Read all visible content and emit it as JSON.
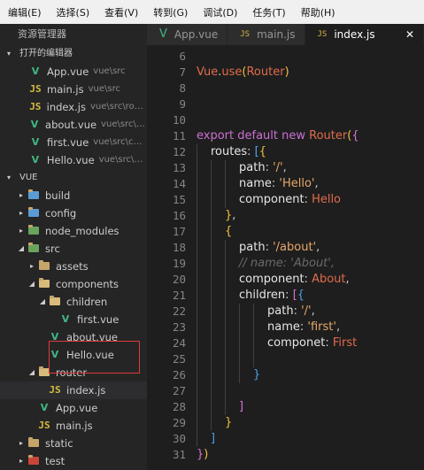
{
  "menu": [
    "编辑(E)",
    "选择(S)",
    "查看(V)",
    "转到(G)",
    "调试(D)",
    "任务(T)",
    "帮助(H)"
  ],
  "sidebar": {
    "title": "资源管理器",
    "open_editors_label": "打开的编辑器",
    "open_editors": [
      {
        "name": "App.vue",
        "path": "vue\\src",
        "type": "vue"
      },
      {
        "name": "main.js",
        "path": "vue\\src",
        "type": "js"
      },
      {
        "name": "index.js",
        "path": "vue\\src\\rou...",
        "type": "js"
      },
      {
        "name": "about.vue",
        "path": "vue\\src\\ro...",
        "type": "vue"
      },
      {
        "name": "first.vue",
        "path": "vue\\src\\co...",
        "type": "vue"
      },
      {
        "name": "Hello.vue",
        "path": "vue\\src\\c...",
        "type": "vue"
      }
    ],
    "project_label": "VUE",
    "tree": [
      {
        "name": "build",
        "kind": "folder",
        "color": "#5a9bd4",
        "depth": 1,
        "arrow": "▸"
      },
      {
        "name": "config",
        "kind": "folder",
        "color": "#5a9bd4",
        "depth": 1,
        "arrow": "▸"
      },
      {
        "name": "node_modules",
        "kind": "folder",
        "color": "#6aa35c",
        "depth": 1,
        "arrow": "▸"
      },
      {
        "name": "src",
        "kind": "folder",
        "color": "#6aa35c",
        "depth": 1,
        "arrow": "◢"
      },
      {
        "name": "assets",
        "kind": "folder",
        "color": "#c5a56a",
        "depth": 2,
        "arrow": "▸"
      },
      {
        "name": "components",
        "kind": "folder",
        "color": "#d8bb7b",
        "depth": 2,
        "arrow": "◢"
      },
      {
        "name": "children",
        "kind": "folder",
        "color": "#d8bb7b",
        "depth": 3,
        "arrow": "◢"
      },
      {
        "name": "first.vue",
        "kind": "vue",
        "depth": 4
      },
      {
        "name": "about.vue",
        "kind": "vue",
        "depth": 3
      },
      {
        "name": "Hello.vue",
        "kind": "vue",
        "depth": 3
      },
      {
        "name": "router",
        "kind": "folder",
        "color": "#d8bb7b",
        "depth": 2,
        "arrow": "◢"
      },
      {
        "name": "index.js",
        "kind": "js",
        "depth": 3,
        "active": true
      },
      {
        "name": "App.vue",
        "kind": "vue",
        "depth": 2
      },
      {
        "name": "main.js",
        "kind": "js",
        "depth": 2
      },
      {
        "name": "static",
        "kind": "folder",
        "color": "#c5a56a",
        "depth": 1,
        "arrow": "▸"
      },
      {
        "name": "test",
        "kind": "folder",
        "color": "#c9453a",
        "depth": 1,
        "arrow": "▸"
      }
    ]
  },
  "tabs": [
    {
      "label": "App.vue",
      "type": "vue",
      "active": false
    },
    {
      "label": "main.js",
      "type": "js",
      "active": false
    },
    {
      "label": "index.js",
      "type": "js",
      "active": true
    }
  ],
  "tab_icon_js": "JS",
  "tab_icon_vue": "V",
  "close_glyph": "✕",
  "editor": {
    "lines": [
      {
        "n": "6",
        "guides": 0,
        "tokens": []
      },
      {
        "n": "7",
        "guides": 0,
        "tokens": [
          {
            "t": "Vue",
            "c": "cls"
          },
          {
            "t": ".",
            "c": "punc"
          },
          {
            "t": "use",
            "c": "fn"
          },
          {
            "t": "(",
            "c": "brk-y"
          },
          {
            "t": "Router",
            "c": "cls"
          },
          {
            "t": ")",
            "c": "brk-y"
          }
        ]
      },
      {
        "n": "8",
        "guides": 0,
        "tokens": []
      },
      {
        "n": "9",
        "guides": 0,
        "tokens": []
      },
      {
        "n": "10",
        "guides": 0,
        "tokens": []
      },
      {
        "n": "11",
        "guides": 0,
        "tokens": [
          {
            "t": "export ",
            "c": "kw"
          },
          {
            "t": "default ",
            "c": "kw"
          },
          {
            "t": "new ",
            "c": "kw"
          },
          {
            "t": "Router",
            "c": "cls"
          },
          {
            "t": "(",
            "c": "brk-y"
          },
          {
            "t": "{",
            "c": "brk-p"
          }
        ]
      },
      {
        "n": "12",
        "guides": 1,
        "tokens": [
          {
            "t": "routes",
            "c": "prop"
          },
          {
            "t": ": ",
            "c": "punc"
          },
          {
            "t": "[",
            "c": "brk-b"
          },
          {
            "t": "{",
            "c": "brk-y"
          }
        ]
      },
      {
        "n": "13",
        "guides": 3,
        "tokens": [
          {
            "t": "path",
            "c": "prop"
          },
          {
            "t": ": ",
            "c": "punc"
          },
          {
            "t": "'/'",
            "c": "str"
          },
          {
            "t": ",",
            "c": "punc"
          }
        ]
      },
      {
        "n": "14",
        "guides": 3,
        "tokens": [
          {
            "t": "name",
            "c": "prop"
          },
          {
            "t": ": ",
            "c": "punc"
          },
          {
            "t": "'Hello'",
            "c": "str"
          },
          {
            "t": ",",
            "c": "punc"
          }
        ]
      },
      {
        "n": "15",
        "guides": 3,
        "tokens": [
          {
            "t": "component",
            "c": "prop"
          },
          {
            "t": ": ",
            "c": "punc"
          },
          {
            "t": "Hello",
            "c": "cls"
          }
        ]
      },
      {
        "n": "16",
        "guides": 2,
        "tokens": [
          {
            "t": "}",
            "c": "brk-y"
          },
          {
            "t": ",",
            "c": "punc"
          }
        ]
      },
      {
        "n": "17",
        "guides": 2,
        "tokens": [
          {
            "t": "{",
            "c": "brk-y"
          }
        ]
      },
      {
        "n": "18",
        "guides": 3,
        "tokens": [
          {
            "t": "path",
            "c": "prop"
          },
          {
            "t": ": ",
            "c": "punc"
          },
          {
            "t": "'/about'",
            "c": "str"
          },
          {
            "t": ",",
            "c": "punc"
          }
        ]
      },
      {
        "n": "19",
        "guides": 3,
        "tokens": [
          {
            "t": "// name: 'About',",
            "c": "cmt"
          }
        ]
      },
      {
        "n": "20",
        "guides": 3,
        "tokens": [
          {
            "t": "component",
            "c": "prop"
          },
          {
            "t": ": ",
            "c": "punc"
          },
          {
            "t": "About",
            "c": "cls"
          },
          {
            "t": ",",
            "c": "punc"
          }
        ]
      },
      {
        "n": "21",
        "guides": 3,
        "tokens": [
          {
            "t": "children",
            "c": "prop"
          },
          {
            "t": ": ",
            "c": "punc"
          },
          {
            "t": "[",
            "c": "brk-p"
          },
          {
            "t": "{",
            "c": "brk-b"
          }
        ]
      },
      {
        "n": "22",
        "guides": 5,
        "tokens": [
          {
            "t": "path",
            "c": "prop"
          },
          {
            "t": ": ",
            "c": "punc"
          },
          {
            "t": "'/'",
            "c": "str"
          },
          {
            "t": ",",
            "c": "punc"
          }
        ]
      },
      {
        "n": "23",
        "guides": 5,
        "tokens": [
          {
            "t": "name",
            "c": "prop"
          },
          {
            "t": ": ",
            "c": "punc"
          },
          {
            "t": "'first'",
            "c": "str"
          },
          {
            "t": ",",
            "c": "punc"
          }
        ]
      },
      {
        "n": "24",
        "guides": 5,
        "tokens": [
          {
            "t": "componet",
            "c": "prop"
          },
          {
            "t": ": ",
            "c": "punc"
          },
          {
            "t": "First",
            "c": "cls"
          }
        ]
      },
      {
        "n": "25",
        "guides": 5,
        "tokens": []
      },
      {
        "n": "26",
        "guides": 4,
        "tokens": [
          {
            "t": "}",
            "c": "brk-b"
          }
        ]
      },
      {
        "n": "27",
        "guides": 3,
        "tokens": []
      },
      {
        "n": "28",
        "guides": 3,
        "tokens": [
          {
            "t": "]",
            "c": "brk-p"
          }
        ]
      },
      {
        "n": "29",
        "guides": 2,
        "tokens": [
          {
            "t": "}",
            "c": "brk-y"
          }
        ]
      },
      {
        "n": "30",
        "guides": 1,
        "tokens": [
          {
            "t": "]",
            "c": "brk-b"
          }
        ]
      },
      {
        "n": "31",
        "guides": 0,
        "tokens": [
          {
            "t": "}",
            "c": "brk-p"
          },
          {
            "t": ")",
            "c": "brk-y"
          }
        ]
      }
    ]
  }
}
